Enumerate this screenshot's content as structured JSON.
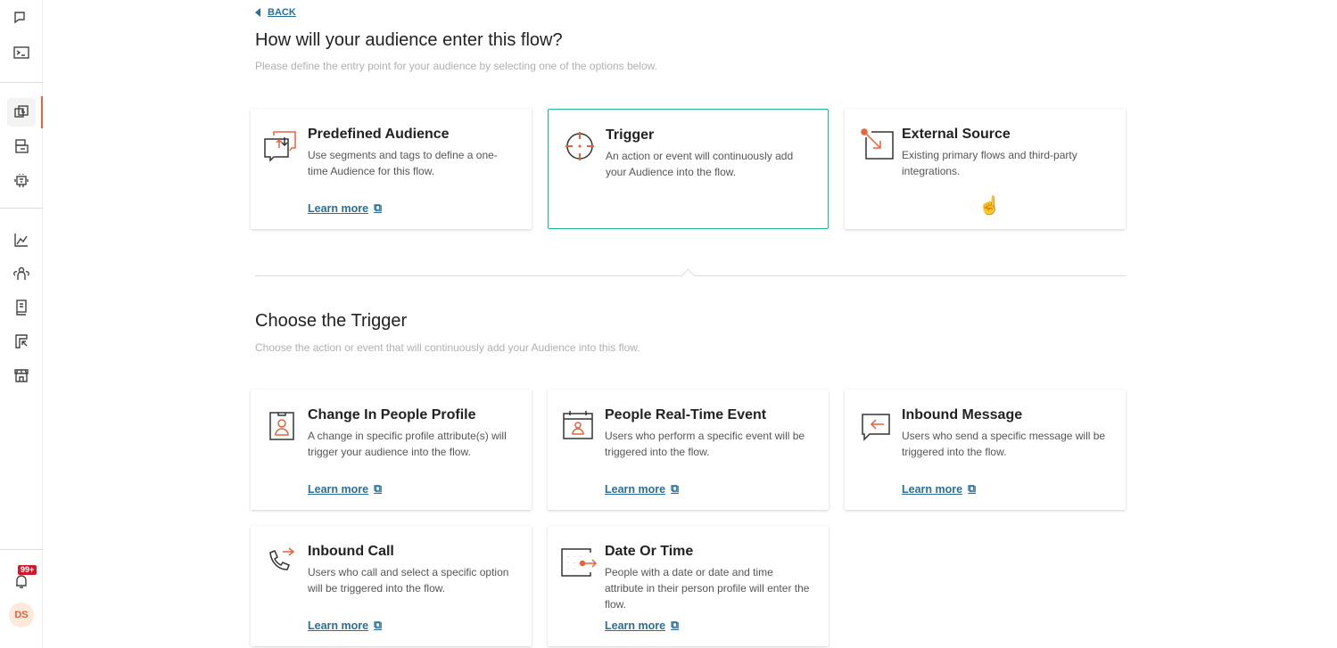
{
  "sidebar": {
    "notification_badge": "99+",
    "avatar_initials": "DS",
    "items": [
      "chat-icon",
      "terminal-icon",
      "flows-icon",
      "campaigns-icon",
      "bot-icon",
      "analytics-icon",
      "audience-icon",
      "catalog-icon",
      "templates-icon",
      "store-icon"
    ]
  },
  "back_label": "BACK",
  "entry": {
    "title": "How will your audience enter this flow?",
    "subtitle": "Please define the entry point for your audience by selecting one of the options below.",
    "cards": [
      {
        "title": "Predefined Audience",
        "desc": "Use segments and tags to define a one-time Audience for this flow.",
        "link": "Learn more"
      },
      {
        "title": "Trigger",
        "desc": "An action or event will continuously add your Audience into the flow.",
        "selected": true
      },
      {
        "title": "External Source",
        "desc": "Existing primary flows and third-party integrations."
      }
    ]
  },
  "trigger": {
    "title": "Choose the Trigger",
    "subtitle": "Choose the action or event that will continuously add your Audience into this flow.",
    "cards": [
      {
        "title": "Change In People Profile",
        "desc": "A change in specific profile attribute(s) will trigger your audience into the flow.",
        "link": "Learn more"
      },
      {
        "title": "People Real-Time Event",
        "desc": "Users who perform a specific event will be triggered into the flow.",
        "link": "Learn more"
      },
      {
        "title": "Inbound Message",
        "desc": "Users who send a specific message will be triggered into the flow.",
        "link": "Learn more"
      },
      {
        "title": "Inbound Call",
        "desc": "Users who call and select a specific option will be triggered into the flow.",
        "link": "Learn more"
      },
      {
        "title": "Date Or Time",
        "desc": "People with a date or date and time attribute in their person profile will enter the flow.",
        "link": "Learn more"
      }
    ]
  },
  "colors": {
    "accent": "#e8623a",
    "link": "#2a6f97",
    "selected_border": "#1fb58f"
  }
}
